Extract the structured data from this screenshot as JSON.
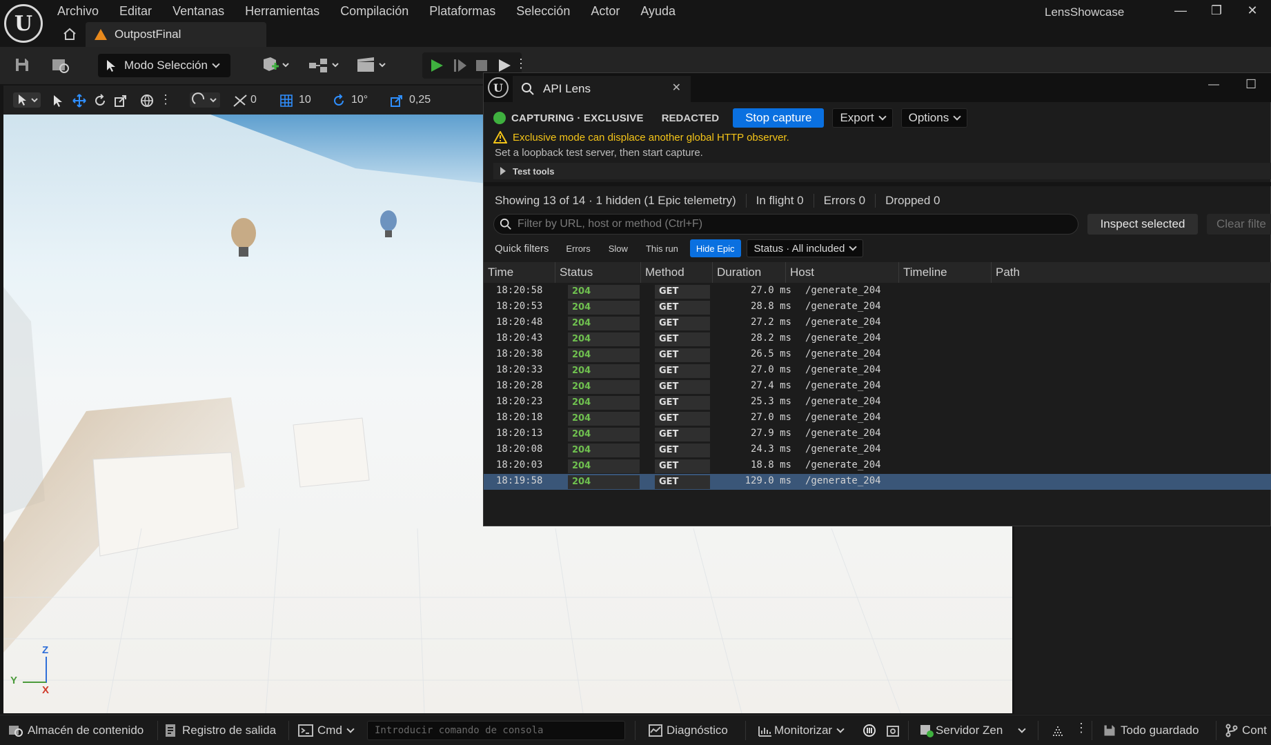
{
  "app": {
    "project_name": "LensShowcase",
    "document_tab": "OutpostFinal"
  },
  "menu": [
    "Archivo",
    "Editar",
    "Ventanas",
    "Herramientas",
    "Compilación",
    "Plataformas",
    "Selección",
    "Actor",
    "Ayuda"
  ],
  "toolbar": {
    "mode_label": "Modo Selección"
  },
  "viewport_toolbar": {
    "rotation_snap_count": "0",
    "grid_snap": "10",
    "rotation_snap": "10°",
    "scale_snap": "0,25"
  },
  "gizmo": {
    "z": "Z",
    "y": "Y",
    "x": "X"
  },
  "lens": {
    "title": "API Lens",
    "capture_state": "CAPTURING · EXCLUSIVE",
    "redacted": "REDACTED",
    "stop_capture": "Stop capture",
    "export": "Export",
    "options": "Options",
    "warning": "Exclusive mode can displace another global HTTP observer.",
    "hint": "Set a loopback test server, then start capture.",
    "test_tools": "Test tools",
    "stats": {
      "showing": "Showing 13 of 14 · 1 hidden (1 Epic telemetry)",
      "in_flight": "In flight 0",
      "errors": "Errors 0",
      "dropped": "Dropped 0"
    },
    "filter_placeholder": "Filter by URL, host or method (Ctrl+F)",
    "inspect_selected": "Inspect selected",
    "clear_filters": "Clear filte",
    "quick_filters_label": "Quick filters",
    "quick_filters": [
      "Errors",
      "Slow",
      "This run",
      "Hide Epic"
    ],
    "active_quick_filter": "Hide Epic",
    "status_filter": "Status · All included",
    "columns": [
      "Time",
      "Status",
      "Method",
      "Duration",
      "Host",
      "Timeline",
      "Path"
    ],
    "rows": [
      {
        "time": "18:20:58",
        "status": "204",
        "method": "GET",
        "duration": "27.0 ms",
        "path": "/generate_204"
      },
      {
        "time": "18:20:53",
        "status": "204",
        "method": "GET",
        "duration": "28.8 ms",
        "path": "/generate_204"
      },
      {
        "time": "18:20:48",
        "status": "204",
        "method": "GET",
        "duration": "27.2 ms",
        "path": "/generate_204"
      },
      {
        "time": "18:20:43",
        "status": "204",
        "method": "GET",
        "duration": "28.2 ms",
        "path": "/generate_204"
      },
      {
        "time": "18:20:38",
        "status": "204",
        "method": "GET",
        "duration": "26.5 ms",
        "path": "/generate_204"
      },
      {
        "time": "18:20:33",
        "status": "204",
        "method": "GET",
        "duration": "27.0 ms",
        "path": "/generate_204"
      },
      {
        "time": "18:20:28",
        "status": "204",
        "method": "GET",
        "duration": "27.4 ms",
        "path": "/generate_204"
      },
      {
        "time": "18:20:23",
        "status": "204",
        "method": "GET",
        "duration": "25.3 ms",
        "path": "/generate_204"
      },
      {
        "time": "18:20:18",
        "status": "204",
        "method": "GET",
        "duration": "27.0 ms",
        "path": "/generate_204"
      },
      {
        "time": "18:20:13",
        "status": "204",
        "method": "GET",
        "duration": "27.9 ms",
        "path": "/generate_204"
      },
      {
        "time": "18:20:08",
        "status": "204",
        "method": "GET",
        "duration": "24.3 ms",
        "path": "/generate_204"
      },
      {
        "time": "18:20:03",
        "status": "204",
        "method": "GET",
        "duration": "18.8 ms",
        "path": "/generate_204"
      },
      {
        "time": "18:19:58",
        "status": "204",
        "method": "GET",
        "duration": "129.0 ms",
        "path": "/generate_204"
      }
    ],
    "selected_row_index": 12
  },
  "bottombar": {
    "content_browser": "Almacén de contenido",
    "output_log": "Registro de salida",
    "cmd": "Cmd",
    "console_placeholder": "Introducir comando de consola",
    "diagnostics": "Diagnóstico",
    "monitor": "Monitorizar",
    "zen_server": "Servidor Zen",
    "all_saved": "Todo guardado",
    "control": "Cont"
  },
  "colors": {
    "accent_blue": "#0a70e0",
    "status_ok": "#6fc04f",
    "warning": "#f5c518",
    "capture_dot": "#3fb13f",
    "selected_row": "#3a5678"
  }
}
